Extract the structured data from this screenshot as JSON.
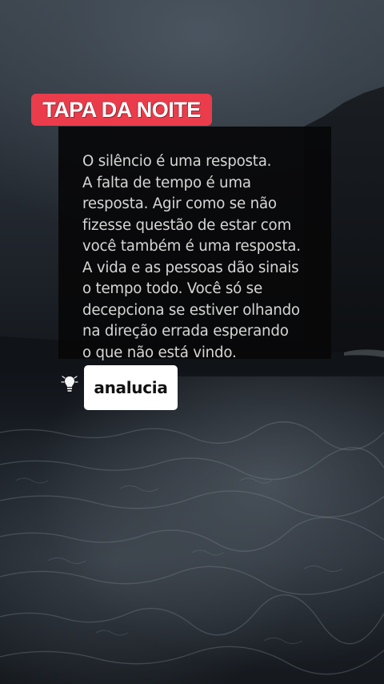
{
  "title_badge": {
    "text": "TAPA DA NOITE",
    "color": "#ea3c4b"
  },
  "quote": {
    "lines": [
      "O silêncio é uma resposta.",
      "A falta de tempo é uma",
      "resposta. Agir como se não",
      "fizesse questão de estar com",
      "você também é uma resposta.",
      "A vida e as pessoas dão sinais",
      "o tempo todo. Você só se",
      "decepciona se estiver olhando",
      "na direção errada esperando",
      "o que não está vindo."
    ]
  },
  "author": {
    "icon": "lightbulb-icon",
    "name": "analucia"
  }
}
